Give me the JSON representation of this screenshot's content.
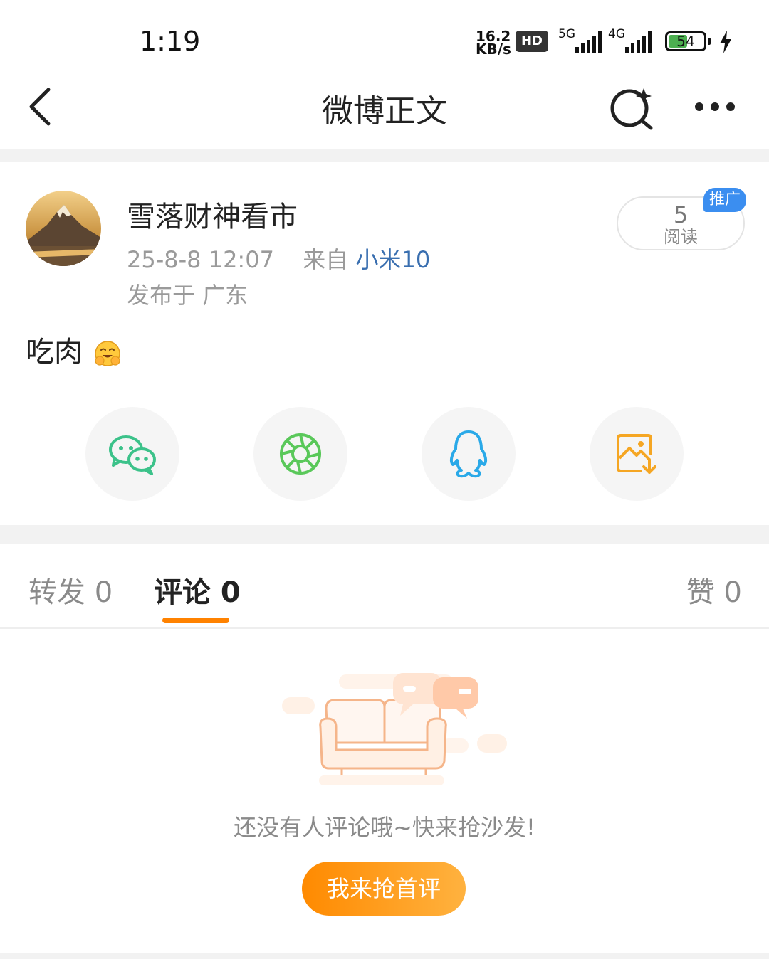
{
  "status_bar": {
    "time": "1:19",
    "net_speed_value": "16.2",
    "net_speed_unit": "KB/s",
    "hd_label": "HD",
    "sim1_label": "5G",
    "sim2_label": "4G",
    "battery": "54",
    "battery_level": 0.54,
    "battery_color": "#4caf50"
  },
  "navbar": {
    "title": "微博正文",
    "back_icon": "chevron-left-icon",
    "search_icon": "ai-search-icon",
    "more_icon": "more-dots-icon"
  },
  "post": {
    "username": "雪落财神看市",
    "timestamp": "25-8-8 12:07",
    "source_prefix": "来自",
    "source": "小米10",
    "location": "发布于 广东",
    "read_count": "5",
    "read_label": "阅读",
    "promo_badge": "推广",
    "content": "吃肉",
    "content_emoji": "hug-face-emoji"
  },
  "share_actions": [
    {
      "icon": "wechat-icon",
      "color": "#3cc28a"
    },
    {
      "icon": "moments-icon",
      "color": "#5ac85a"
    },
    {
      "icon": "qq-icon",
      "color": "#2aa9e8"
    },
    {
      "icon": "save-image-icon",
      "color": "#f5a623"
    }
  ],
  "tabs": {
    "repost": "转发 0",
    "comments": "评论 0",
    "likes": "赞 0",
    "active": "comments",
    "accent_color": "#ff8200"
  },
  "empty_state": {
    "message": "还没有人评论哦~快来抢沙发!",
    "button": "我来抢首评"
  }
}
